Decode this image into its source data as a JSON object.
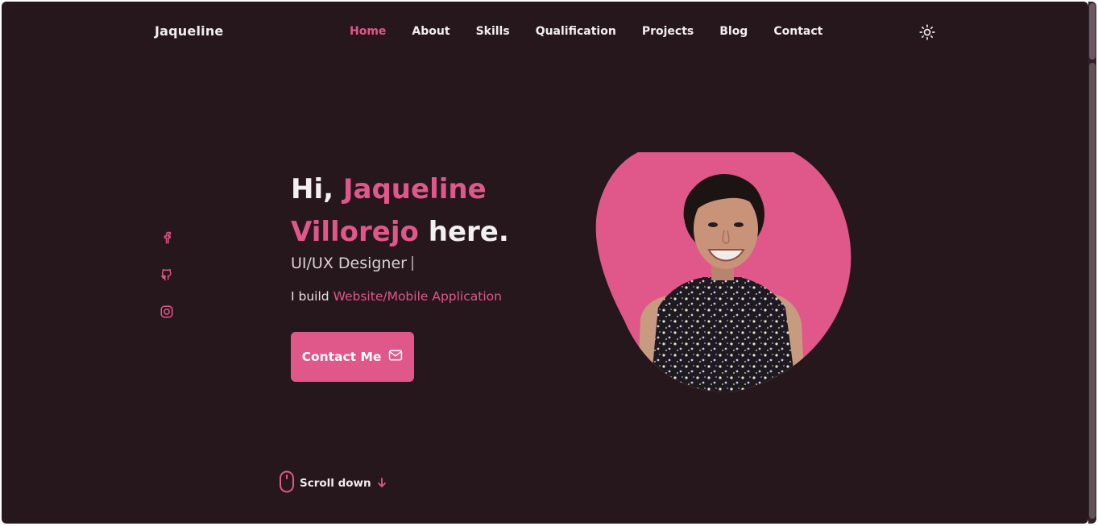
{
  "header": {
    "logo": "Jaqueline",
    "nav": [
      {
        "label": "Home",
        "active": true
      },
      {
        "label": "About",
        "active": false
      },
      {
        "label": "Skills",
        "active": false
      },
      {
        "label": "Qualification",
        "active": false
      },
      {
        "label": "Projects",
        "active": false
      },
      {
        "label": "Blog",
        "active": false
      },
      {
        "label": "Contact",
        "active": false
      }
    ],
    "theme_icon": "sun-icon"
  },
  "socials": [
    {
      "name": "facebook-icon"
    },
    {
      "name": "github-icon"
    },
    {
      "name": "instagram-icon"
    }
  ],
  "hero": {
    "greeting": "Hi,",
    "first_name": "Jaqueline",
    "last_name": "Villorejo",
    "suffix": "here.",
    "role": "UI/UX Designer",
    "tagline_prefix": "I build",
    "tagline_highlight": "Website/Mobile Application",
    "cta_label": "Contact Me",
    "cta_icon": "mail-icon",
    "photo": "profile-photo"
  },
  "scroll": {
    "label": "Scroll down",
    "icon": "mouse-icon",
    "arrow_icon": "arrow-down-icon"
  },
  "colors": {
    "background": "#26171d",
    "accent": "#e0578a",
    "text": "#f2eef0"
  }
}
